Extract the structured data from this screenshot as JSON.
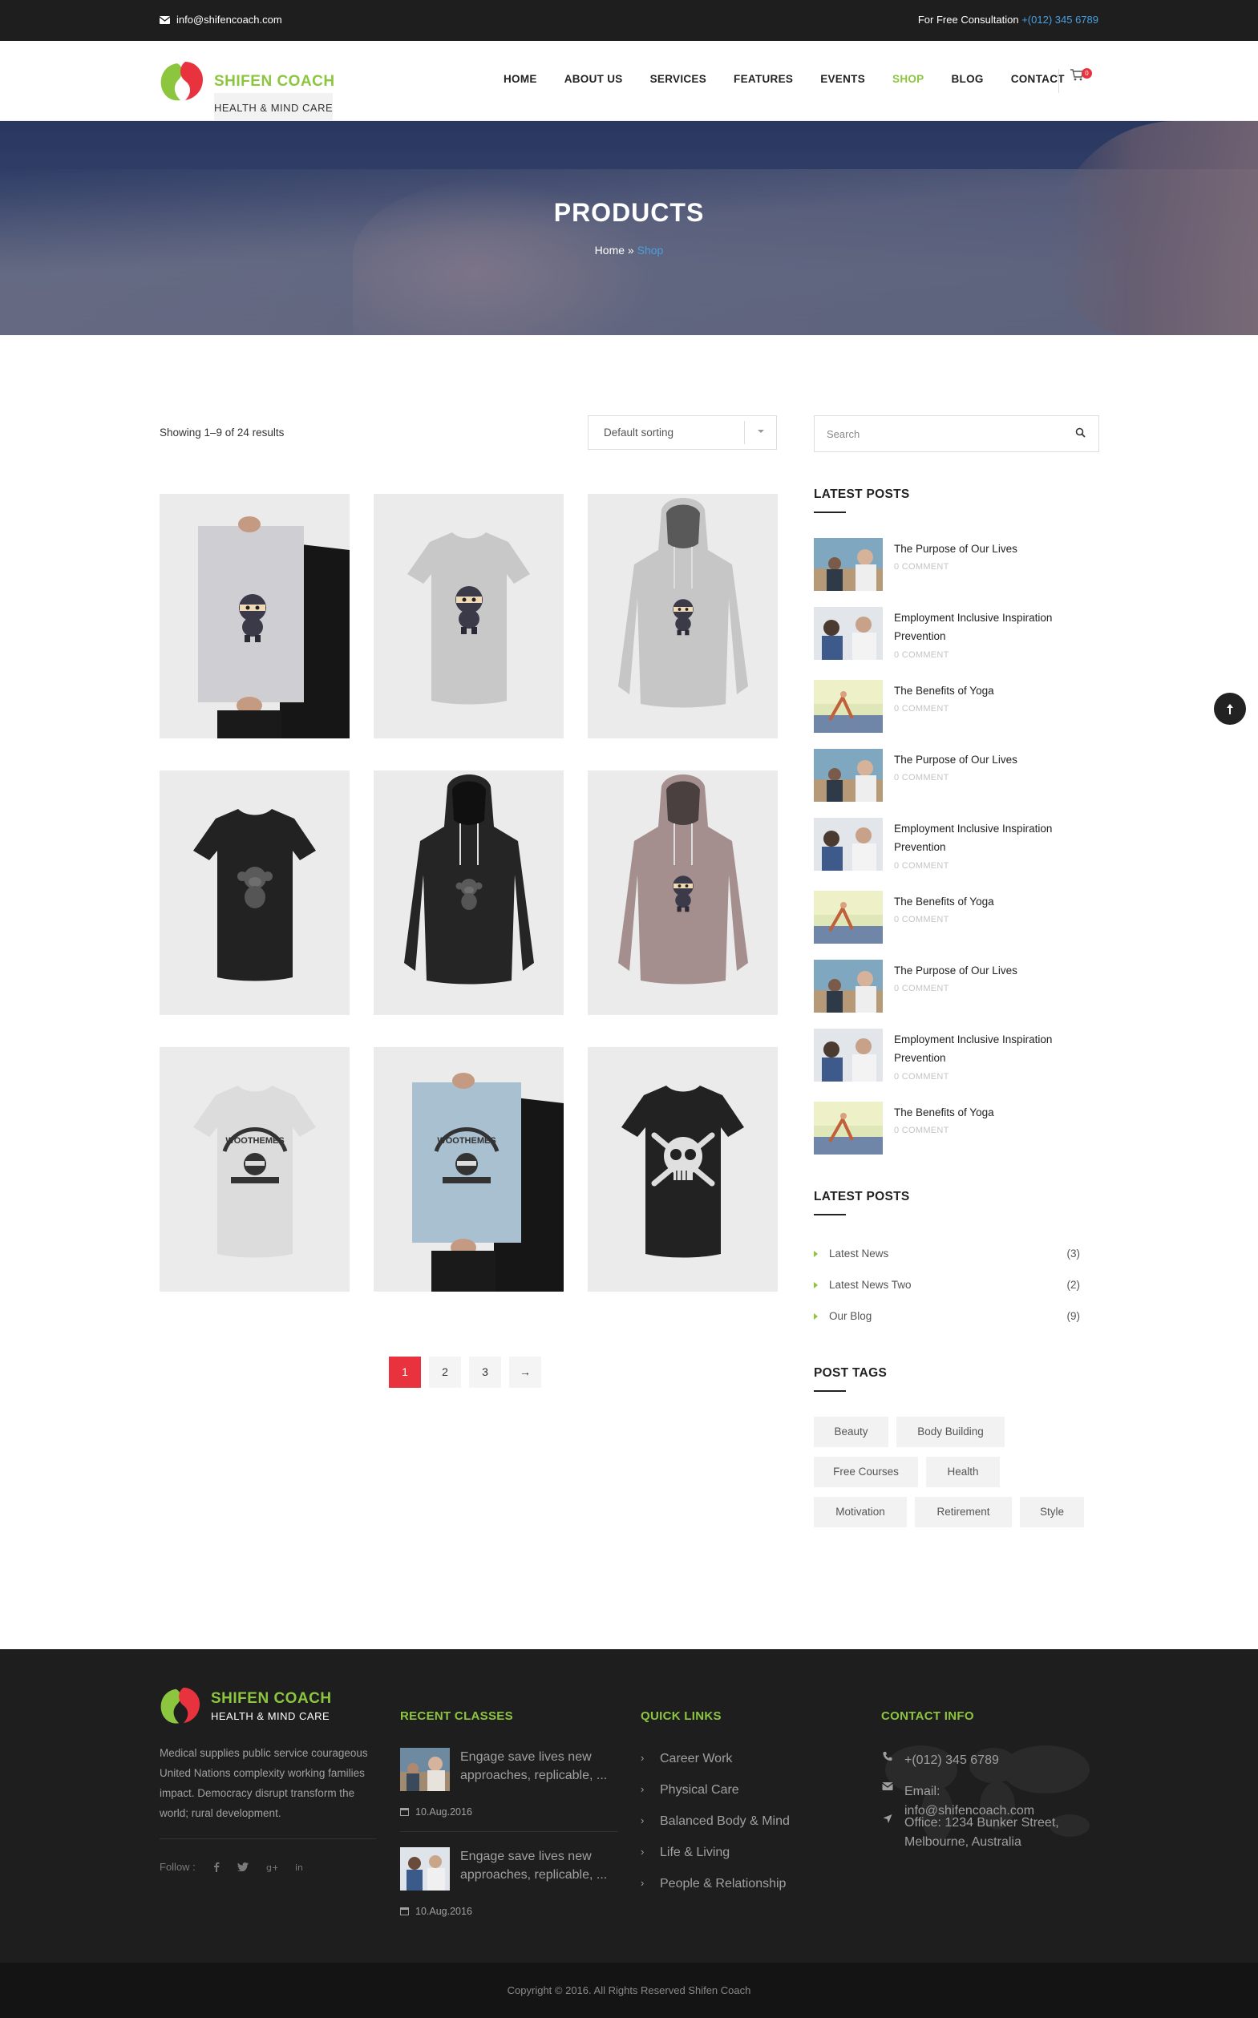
{
  "topbar": {
    "email": "info@shifencoach.com",
    "consult_label": "For Free Consultation",
    "phone": "+(012) 345 6789"
  },
  "brand": {
    "name": "SHIFEN COACH",
    "tagline": "HEALTH & MIND CARE"
  },
  "nav": {
    "items": [
      "HOME",
      "ABOUT US",
      "SERVICES",
      "FEATURES",
      "EVENTS",
      "SHOP",
      "BLOG",
      "CONTACT"
    ],
    "active": "SHOP",
    "cart_count": "0"
  },
  "hero": {
    "title": "PRODUCTS",
    "crumb_home": "Home",
    "crumb_sep": "»",
    "crumb_current": "Shop"
  },
  "shop": {
    "results": "Showing 1–9 of 24 results",
    "sorting": "Default sorting",
    "products": [
      {
        "kind": "poster",
        "art": "ninja"
      },
      {
        "kind": "tshirt",
        "art": "ninja",
        "color": "#c8c8c8"
      },
      {
        "kind": "hoodie",
        "art": "ninja",
        "color": "#c6c6c6"
      },
      {
        "kind": "tshirt",
        "art": "monkey",
        "color": "#222222"
      },
      {
        "kind": "hoodie",
        "art": "monkey",
        "color": "#252525"
      },
      {
        "kind": "hoodie",
        "art": "ninja",
        "color": "#a58e8e"
      },
      {
        "kind": "tshirt",
        "art": "woothemes",
        "color": "#dcdcdc"
      },
      {
        "kind": "poster",
        "art": "woothemes"
      },
      {
        "kind": "tshirt",
        "art": "skull",
        "color": "#222222"
      }
    ],
    "pages": [
      "1",
      "2",
      "3",
      "→"
    ],
    "current_page": "1"
  },
  "sidebar": {
    "search_placeholder": "Search",
    "latest_posts_title": "LATEST POSTS",
    "posts": [
      {
        "title": "The Purpose of Our Lives",
        "meta": "0 COMMENT",
        "thumb": "beach"
      },
      {
        "title": "Employment Inclusive Inspiration Prevention",
        "meta": "0 COMMENT",
        "thumb": "office"
      },
      {
        "title": "The Benefits of Yoga",
        "meta": "0 COMMENT",
        "thumb": "yoga"
      },
      {
        "title": "The Purpose of Our Lives",
        "meta": "0 COMMENT",
        "thumb": "beach"
      },
      {
        "title": "Employment Inclusive Inspiration Prevention",
        "meta": "0 COMMENT",
        "thumb": "office"
      },
      {
        "title": "The Benefits of Yoga",
        "meta": "0 COMMENT",
        "thumb": "yoga"
      },
      {
        "title": "The Purpose of Our Lives",
        "meta": "0 COMMENT",
        "thumb": "beach"
      },
      {
        "title": "Employment Inclusive Inspiration Prevention",
        "meta": "0 COMMENT",
        "thumb": "office"
      },
      {
        "title": "The Benefits of Yoga",
        "meta": "0 COMMENT",
        "thumb": "yoga"
      }
    ],
    "categories_title": "LATEST POSTS",
    "categories": [
      {
        "label": "Latest News",
        "count": "(3)"
      },
      {
        "label": "Latest News Two",
        "count": "(2)"
      },
      {
        "label": "Our Blog",
        "count": "(9)"
      }
    ],
    "tags_title": "POST TAGS",
    "tags": [
      "Beauty",
      "Body Building",
      "Free Courses",
      "Health",
      "Motivation",
      "Retirement",
      "Style"
    ]
  },
  "footer": {
    "about": "Medical supplies public service courageous United Nations complexity working families impact. Democracy disrupt transform the world; rural development.",
    "follow_label": "Follow :",
    "social_icons": [
      "facebook-icon",
      "twitter-icon",
      "google-plus-icon",
      "linkedin-icon"
    ],
    "recent_title": "RECENT CLASSES",
    "classes": [
      {
        "text": "Engage save lives new approaches, replicable, ...",
        "date": "10.Aug.2016"
      },
      {
        "text": "Engage save lives new approaches, replicable, ...",
        "date": "10.Aug.2016"
      }
    ],
    "quick_title": "QUICK LINKS",
    "quick_links": [
      "Career Work",
      "Physical Care",
      "Balanced Body & Mind",
      "Life & Living",
      "People & Relationship"
    ],
    "contact_title": "CONTACT INFO",
    "contact": {
      "phone": "+(012) 345 6789",
      "email": "Email: info@shifencoach.com",
      "office": "Office: 1234 Bunker Street, Melbourne, Australia"
    },
    "copyright": "Copyright © 2016. All Rights Reserved Shifen Coach"
  },
  "colors": {
    "accent": "#8cc63f",
    "link": "#4a9fe0",
    "red": "#e8333f",
    "dark": "#1e1e1e"
  }
}
